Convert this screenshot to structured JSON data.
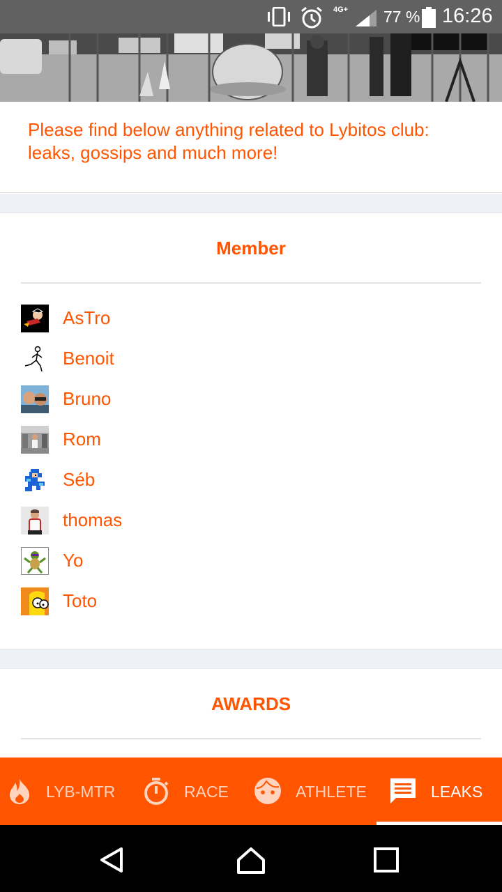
{
  "status_bar": {
    "network": "4G+",
    "battery_percent": "77 %",
    "time": "16:26",
    "icons": [
      "vibrate-icon",
      "alarm-icon",
      "signal-icon",
      "battery-icon"
    ]
  },
  "intro": {
    "text": "Please find below anything related to Lybitos club: leaks, gossips and much more!"
  },
  "member_section": {
    "title": "Member",
    "members": [
      {
        "name": "AsTro"
      },
      {
        "name": "Benoit"
      },
      {
        "name": "Bruno"
      },
      {
        "name": "Rom"
      },
      {
        "name": "Séb"
      },
      {
        "name": "thomas"
      },
      {
        "name": "Yo"
      },
      {
        "name": "Toto"
      }
    ]
  },
  "awards_section": {
    "title": "AWARDS"
  },
  "tabs": [
    {
      "label": "LYB-MTR",
      "icon": "flame-icon"
    },
    {
      "label": "RACE",
      "icon": "stopwatch-icon"
    },
    {
      "label": "ATHLETE",
      "icon": "face-icon"
    },
    {
      "label": "LEAKS",
      "icon": "chat-icon",
      "active": true
    }
  ],
  "colors": {
    "accent": "#ff5500",
    "status_bar": "#616161",
    "nav_bar": "#000000"
  }
}
